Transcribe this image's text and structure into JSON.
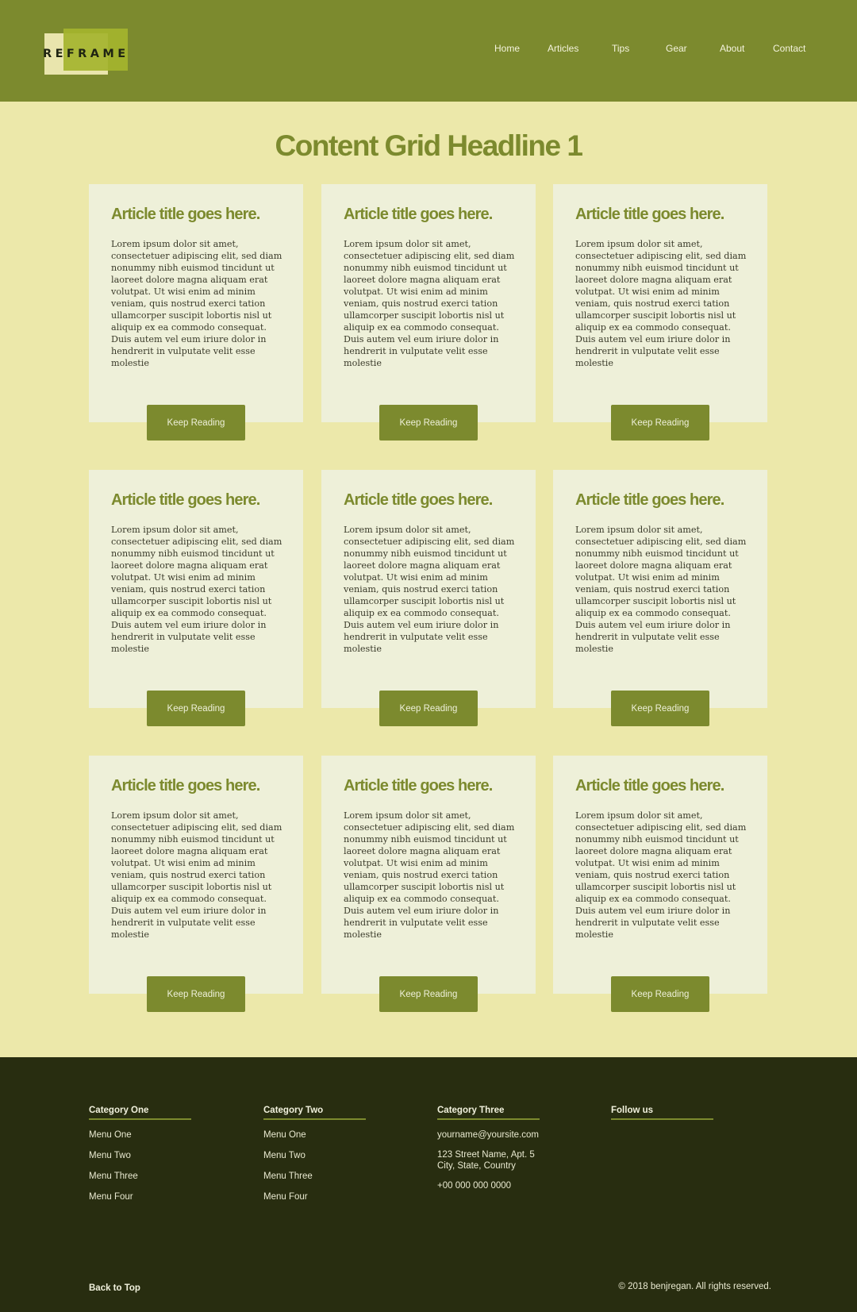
{
  "brand": {
    "logo_text": "REFRAME"
  },
  "nav": [
    "Home",
    "Articles",
    "Tips",
    "Gear",
    "About",
    "Contact"
  ],
  "main": {
    "headline": "Content Grid Headline 1",
    "cards": [
      {
        "title": "Article title goes here.",
        "body": "Lorem ipsum dolor sit amet, consectetuer adipiscing elit, sed diam nonummy nibh euismod tincidunt ut laoreet dolore magna aliquam erat volutpat. Ut wisi enim ad minim veniam, quis nostrud exerci tation ullamcorper suscipit lobortis nisl ut aliquip ex ea commodo consequat. Duis autem vel eum iriure dolor in hendrerit in vulputate velit esse molestie",
        "button": "Keep Reading"
      },
      {
        "title": "Article title goes here.",
        "body": "Lorem ipsum dolor sit amet, consectetuer adipiscing elit, sed diam nonummy nibh euismod tincidunt ut laoreet dolore magna aliquam erat volutpat. Ut wisi enim ad minim veniam, quis nostrud exerci tation ullamcorper suscipit lobortis nisl ut aliquip ex ea commodo consequat. Duis autem vel eum iriure dolor in hendrerit in vulputate velit esse molestie",
        "button": "Keep Reading"
      },
      {
        "title": "Article title goes here.",
        "body": "Lorem ipsum dolor sit amet, consectetuer adipiscing elit, sed diam nonummy nibh euismod tincidunt ut laoreet dolore magna aliquam erat volutpat. Ut wisi enim ad minim veniam, quis nostrud exerci tation ullamcorper suscipit lobortis nisl ut aliquip ex ea commodo consequat. Duis autem vel eum iriure dolor in hendrerit in vulputate velit esse molestie",
        "button": "Keep Reading"
      },
      {
        "title": "Article title goes here.",
        "body": "Lorem ipsum dolor sit amet, consectetuer adipiscing elit, sed diam nonummy nibh euismod tincidunt ut laoreet dolore magna aliquam erat volutpat. Ut wisi enim ad minim veniam, quis nostrud exerci tation ullamcorper suscipit lobortis nisl ut aliquip ex ea commodo consequat. Duis autem vel eum iriure dolor in hendrerit in vulputate velit esse molestie",
        "button": "Keep Reading"
      },
      {
        "title": "Article title goes here.",
        "body": "Lorem ipsum dolor sit amet, consectetuer adipiscing elit, sed diam nonummy nibh euismod tincidunt ut laoreet dolore magna aliquam erat volutpat. Ut wisi enim ad minim veniam, quis nostrud exerci tation ullamcorper suscipit lobortis nisl ut aliquip ex ea commodo consequat. Duis autem vel eum iriure dolor in hendrerit in vulputate velit esse molestie",
        "button": "Keep Reading"
      },
      {
        "title": "Article title goes here.",
        "body": "Lorem ipsum dolor sit amet, consectetuer adipiscing elit, sed diam nonummy nibh euismod tincidunt ut laoreet dolore magna aliquam erat volutpat. Ut wisi enim ad minim veniam, quis nostrud exerci tation ullamcorper suscipit lobortis nisl ut aliquip ex ea commodo consequat. Duis autem vel eum iriure dolor in hendrerit in vulputate velit esse molestie",
        "button": "Keep Reading"
      },
      {
        "title": "Article title goes here.",
        "body": "Lorem ipsum dolor sit amet, consectetuer adipiscing elit, sed diam nonummy nibh euismod tincidunt ut laoreet dolore magna aliquam erat volutpat. Ut wisi enim ad minim veniam, quis nostrud exerci tation ullamcorper suscipit lobortis nisl ut aliquip ex ea commodo consequat. Duis autem vel eum iriure dolor in hendrerit in vulputate velit esse molestie",
        "button": "Keep Reading"
      },
      {
        "title": "Article title goes here.",
        "body": "Lorem ipsum dolor sit amet, consectetuer adipiscing elit, sed diam nonummy nibh euismod tincidunt ut laoreet dolore magna aliquam erat volutpat. Ut wisi enim ad minim veniam, quis nostrud exerci tation ullamcorper suscipit lobortis nisl ut aliquip ex ea commodo consequat. Duis autem vel eum iriure dolor in hendrerit in vulputate velit esse molestie",
        "button": "Keep Reading"
      },
      {
        "title": "Article title goes here.",
        "body": "Lorem ipsum dolor sit amet, consectetuer adipiscing elit, sed diam nonummy nibh euismod tincidunt ut laoreet dolore magna aliquam erat volutpat. Ut wisi enim ad minim veniam, quis nostrud exerci tation ullamcorper suscipit lobortis nisl ut aliquip ex ea commodo consequat. Duis autem vel eum iriure dolor in hendrerit in vulputate velit esse molestie",
        "button": "Keep Reading"
      }
    ]
  },
  "footer": {
    "columns": [
      {
        "heading": "Category One",
        "items": [
          "Menu One",
          "Menu Two",
          "Menu Three",
          "Menu Four"
        ]
      },
      {
        "heading": "Category Two",
        "items": [
          "Menu One",
          "Menu Two",
          "Menu Three",
          "Menu Four"
        ]
      },
      {
        "heading": "Category Three",
        "items": [
          "yourname@yoursite.com",
          "123 Street Name, Apt. 5",
          "City, State, Country",
          "+00 000 000 0000"
        ]
      },
      {
        "heading": "Follow us",
        "items": []
      }
    ],
    "back_to_top": "Back to Top",
    "copyright": "© 2018 benjregan. All rights reserved."
  },
  "colors": {
    "header": "#7c8a2e",
    "page_bg": "#ece8aa",
    "card_bg": "#eef0d9",
    "accent": "#7c8a2e",
    "footer_bg": "#282d10"
  }
}
